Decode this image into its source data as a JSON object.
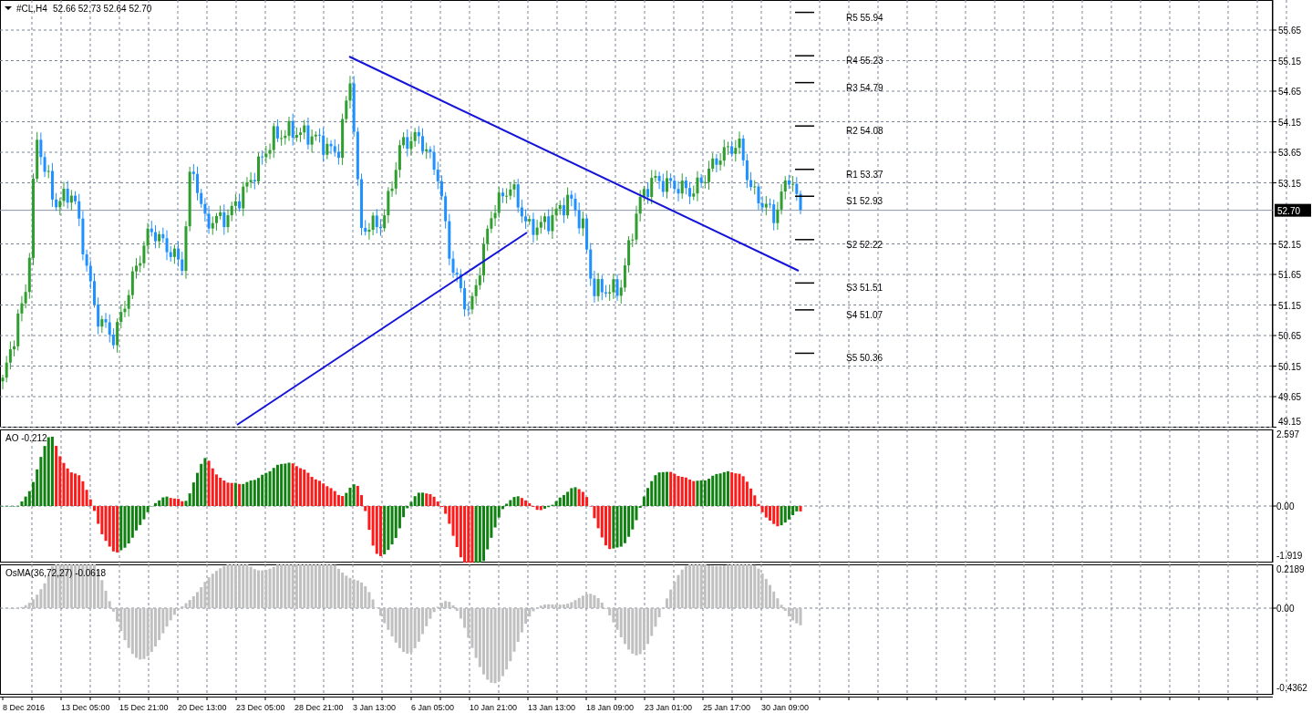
{
  "chart": {
    "symbol": "#CL,H4",
    "quote": "52.66 52.73 52.64 52.70",
    "price_axis": [
      "55.65",
      "55.15",
      "54.65",
      "54.15",
      "53.65",
      "53.15",
      "52.15",
      "51.65",
      "51.15",
      "50.65",
      "50.15",
      "49.65",
      "49.15"
    ],
    "current_price": "52.70",
    "pivots": [
      "R5 55.94",
      "R4 55.23",
      "R3 54.79",
      "R2 54.08",
      "R1 53.37",
      "S1 52.93",
      "S2 52.22",
      "S3 51.51",
      "S4 51.07",
      "S5 50.36"
    ]
  },
  "indicators": [
    {
      "kind": "ao",
      "label": "AO -0.212",
      "axis": [
        "2.597",
        "0.00",
        "-1.919"
      ]
    },
    {
      "kind": "osma",
      "label": "OsMA(36,72,27) -0.0618",
      "axis": [
        "0.2189",
        "0.00",
        "-0.4362"
      ]
    }
  ],
  "time_axis": [
    "8 Dec 2016",
    "13 Dec 05:00",
    "15 Dec 21:00",
    "20 Dec 13:00",
    "23 Dec 05:00",
    "28 Dec 21:00",
    "3 Jan 13:00",
    "6 Jan 05:00",
    "10 Jan 21:00",
    "13 Jan 13:00",
    "18 Jan 09:00",
    "23 Jan 01:00",
    "25 Jan 17:00",
    "30 Jan 09:00"
  ]
}
